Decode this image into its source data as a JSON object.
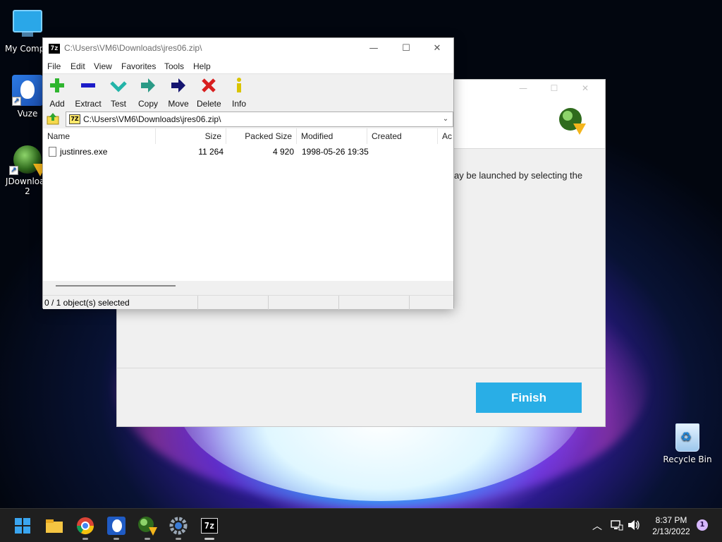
{
  "desktop": {
    "icons": [
      {
        "label": "My Compu",
        "icon": "computer-icon"
      },
      {
        "label": "Vuze",
        "icon": "vuze-icon"
      },
      {
        "label": "JDownloac",
        "label2": "2",
        "icon": "jdownloader-icon"
      },
      {
        "label": "Recycle Bin",
        "icon": "recycle-bin-icon"
      }
    ]
  },
  "installer": {
    "body_text": "ay be launched by selecting the",
    "finish_label": "Finish",
    "accent": "#29aee6"
  },
  "zip": {
    "title": "C:\\Users\\VM6\\Downloads\\jres06.zip\\",
    "app_icon_text": "7z",
    "menu": [
      "File",
      "Edit",
      "View",
      "Favorites",
      "Tools",
      "Help"
    ],
    "toolbar": [
      {
        "label": "Add",
        "icon": "plus-icon"
      },
      {
        "label": "Extract",
        "icon": "minus-icon"
      },
      {
        "label": "Test",
        "icon": "check-icon"
      },
      {
        "label": "Copy",
        "icon": "arrow-right-icon"
      },
      {
        "label": "Move",
        "icon": "arrow-right-dark-icon"
      },
      {
        "label": "Delete",
        "icon": "x-icon"
      },
      {
        "label": "Info",
        "icon": "info-icon"
      }
    ],
    "address": "C:\\Users\\VM6\\Downloads\\jres06.zip\\",
    "address_icon_text": "7Z",
    "columns": [
      "Name",
      "Size",
      "Packed Size",
      "Modified",
      "Created",
      "Ac"
    ],
    "files": [
      {
        "name": "justinres.exe",
        "size": "11 264",
        "packed": "4 920",
        "modified": "1998-05-26 19:35",
        "created": ""
      }
    ],
    "status": "0 / 1 object(s) selected"
  },
  "taskbar": {
    "apps": [
      "start-icon",
      "file-explorer-icon",
      "chrome-icon",
      "vuze-icon",
      "jdownloader-icon",
      "settings-icon",
      "7zip-icon"
    ],
    "sevenzip_text": "7z",
    "time": "8:37 PM",
    "date": "2/13/2022",
    "notification_count": "1"
  }
}
